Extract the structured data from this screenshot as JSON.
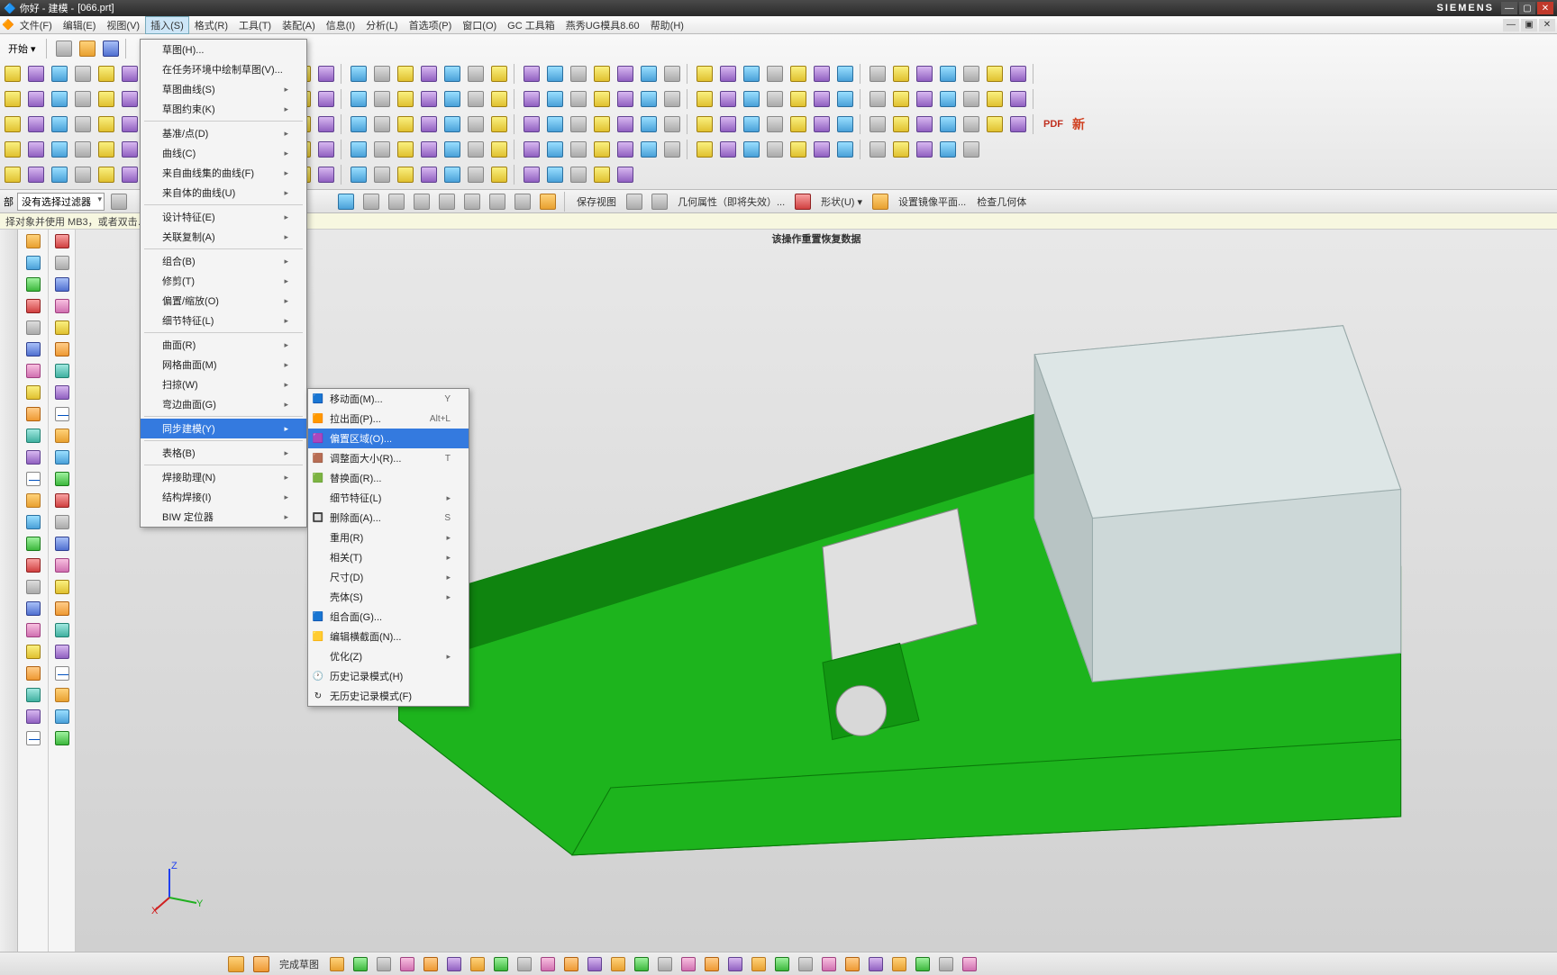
{
  "title": {
    "prefix": "你好 - 建模 - ",
    "doc": "[066.prt]",
    "brand": "SIEMENS"
  },
  "menu": [
    "文件(F)",
    "编辑(E)",
    "视图(V)",
    "插入(S)",
    "格式(R)",
    "工具(T)",
    "装配(A)",
    "信息(I)",
    "分析(L)",
    "首选项(P)",
    "窗口(O)",
    "GC 工具箱",
    "燕秀UG模具8.60",
    "帮助(H)"
  ],
  "start_btn": "开始 ▾",
  "filter_combo": "没有选择过滤器",
  "hint": "择对象并使用 MB3，或者双击…",
  "status_message": "该操作重置恢复数据",
  "insert_menu": [
    {
      "label": "草图(H)...",
      "arrow": false
    },
    {
      "label": "在任务环境中绘制草图(V)...",
      "arrow": false
    },
    {
      "label": "草图曲线(S)",
      "arrow": true
    },
    {
      "label": "草图约束(K)",
      "arrow": true
    },
    {
      "sep": true
    },
    {
      "label": "基准/点(D)",
      "arrow": true
    },
    {
      "label": "曲线(C)",
      "arrow": true
    },
    {
      "label": "来自曲线集的曲线(F)",
      "arrow": true
    },
    {
      "label": "来自体的曲线(U)",
      "arrow": true
    },
    {
      "sep": true
    },
    {
      "label": "设计特征(E)",
      "arrow": true
    },
    {
      "label": "关联复制(A)",
      "arrow": true
    },
    {
      "sep": true
    },
    {
      "label": "组合(B)",
      "arrow": true
    },
    {
      "label": "修剪(T)",
      "arrow": true
    },
    {
      "label": "偏置/缩放(O)",
      "arrow": true
    },
    {
      "label": "细节特征(L)",
      "arrow": true
    },
    {
      "sep": true
    },
    {
      "label": "曲面(R)",
      "arrow": true
    },
    {
      "label": "网格曲面(M)",
      "arrow": true
    },
    {
      "label": "扫掠(W)",
      "arrow": true
    },
    {
      "label": "弯边曲面(G)",
      "arrow": true
    },
    {
      "sep": true
    },
    {
      "label": "同步建模(Y)",
      "arrow": true,
      "selected": true
    },
    {
      "sep": true
    },
    {
      "label": "表格(B)",
      "arrow": true
    },
    {
      "sep": true
    },
    {
      "label": "焊接助理(N)",
      "arrow": true
    },
    {
      "label": "结构焊接(I)",
      "arrow": true
    },
    {
      "label": "BIW 定位器",
      "arrow": true
    }
  ],
  "sync_submenu": [
    {
      "label": "移动面(M)...",
      "short": "Y",
      "icon": "🟦"
    },
    {
      "label": "拉出面(P)...",
      "short": "Alt+L",
      "icon": "🟧"
    },
    {
      "label": "偏置区域(O)...",
      "short": "",
      "icon": "🟪",
      "selected": true
    },
    {
      "label": "调整面大小(R)...",
      "short": "T",
      "icon": "🟫"
    },
    {
      "label": "替换面(R)...",
      "short": "",
      "icon": "🟩"
    },
    {
      "label": "细节特征(L)",
      "arrow": true
    },
    {
      "label": "删除面(A)...",
      "short": "S",
      "icon": "🔲"
    },
    {
      "label": "重用(R)",
      "arrow": true
    },
    {
      "label": "相关(T)",
      "arrow": true
    },
    {
      "label": "尺寸(D)",
      "arrow": true
    },
    {
      "label": "壳体(S)",
      "arrow": true
    },
    {
      "label": "组合面(G)...",
      "icon": "🟦"
    },
    {
      "label": "编辑横截面(N)...",
      "icon": "🟨"
    },
    {
      "label": "优化(Z)",
      "arrow": true
    },
    {
      "label": "历史记录模式(H)",
      "icon": "🕐"
    },
    {
      "label": "无历史记录模式(F)",
      "icon": "↻"
    }
  ],
  "status_buttons": {
    "save_view": "保存视图",
    "geom_attr": "几何属性（即将失效）...",
    "shape": "形状(U) ▾",
    "mirror_plane": "设置镜像平面...",
    "check_geom": "检查几何体"
  },
  "bottom": {
    "finish_sketch": "完成草图"
  },
  "pdf_label": "PDF",
  "new_label": "新"
}
